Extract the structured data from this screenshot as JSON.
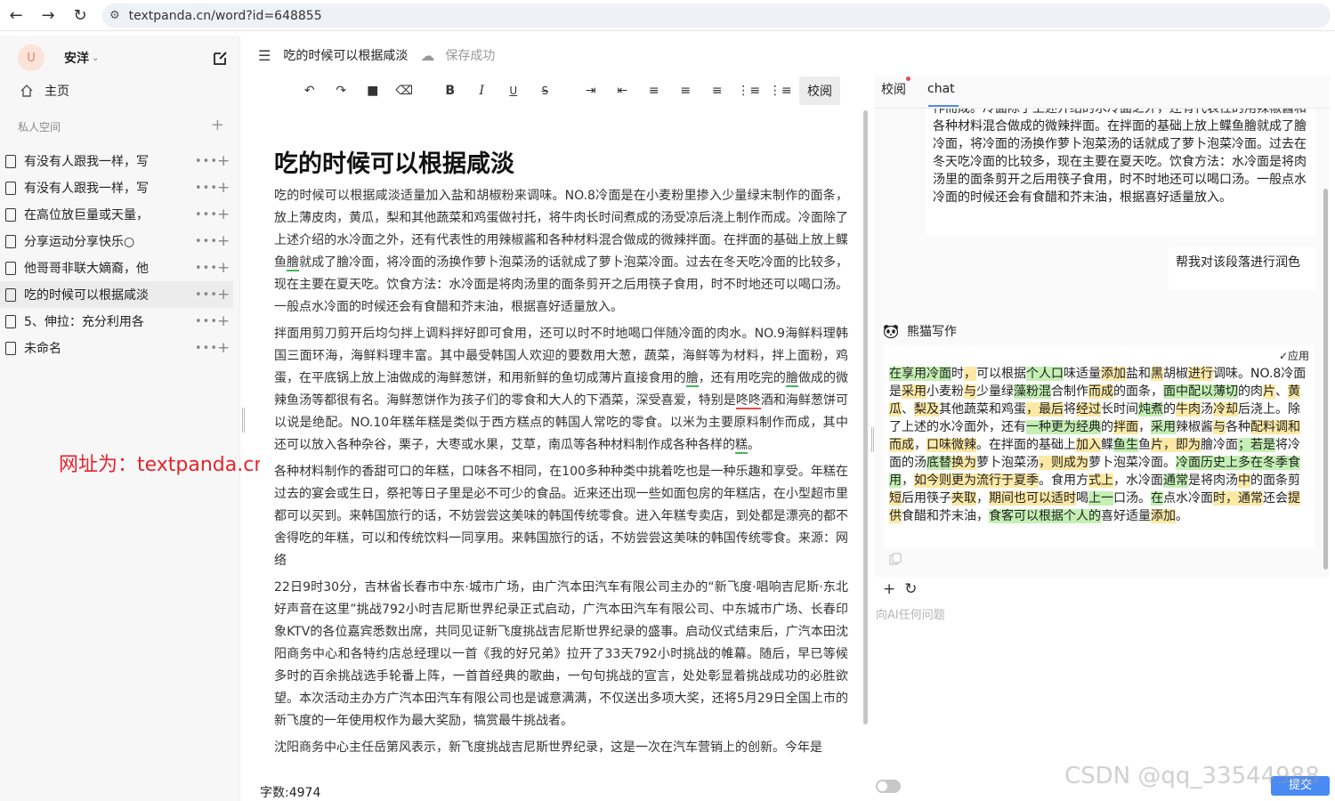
{
  "browser": {
    "url": "textpanda.cn/word?id=648855"
  },
  "sidebar": {
    "avatar_letter": "U",
    "user_name": "安洋",
    "home_label": "主页",
    "space_label": "私人空间",
    "docs": [
      {
        "title": "有没有人跟我一样，写"
      },
      {
        "title": "有没有人跟我一样，写"
      },
      {
        "title": "在高位放巨量或天量，"
      },
      {
        "title": "分享运动分享快乐○"
      },
      {
        "title": "他哥哥非联大嫡裔，他"
      },
      {
        "title": "吃的时候可以根据咸淡"
      },
      {
        "title": "5、伸拉：充分利用各"
      },
      {
        "title": "未命名"
      }
    ],
    "watermark": "网址为：textpanda.cn"
  },
  "header": {
    "doc_name": "吃的时候可以根据咸淡",
    "save_status": "保存成功"
  },
  "toolbar": {
    "check_label": "校阅"
  },
  "editor": {
    "title": "吃的时候可以根据咸淡",
    "p1_a": "吃的时候可以根据咸淡适量加入盐和胡椒粉来调味。NO.8冷面是在小麦粉里掺入少量绿末制作的面条，放上薄皮肉，黄瓜，梨和其他蔬菜和鸡蛋做衬托，将牛肉长时间煮成的汤受凉后浇上制作而成。冷面除了上述介绍的水冷面之外，还有代表性的用辣椒酱和各种材料混合做成的微辣拌面。在拌面的基础上放上鲽鱼",
    "p1_u": "膾",
    "p1_b": "就成了膾冷面，将冷面的汤换作萝卜泡菜汤的话就成了萝卜泡菜冷面。过去在冬天吃冷面的比较多，现在主要在夏天吃。饮食方法：水冷面是将肉汤里的面条剪开之后用筷子食用，时不时地还可以喝口汤。一般点水冷面的时候还会有食醋和芥末油，根据喜好适量放入。",
    "p2_a": "拌面用剪刀剪开后均匀拌上调料拌好即可食用，还可以时不时地喝口伴随冷面的肉水。NO.9海鲜料理韩国三面环海，海鲜料理丰富。其中最受韩国人欢迎的要数用大葱，蔬菜，海鲜等为材料，拌上面粉，鸡蛋，在平底锅上放上油做成的海鲜葱饼，和用新鲜的鱼切成薄片直接食用的",
    "p2_u1": "膾",
    "p2_b": "，还有用吃完的",
    "p2_u2": "膾",
    "p2_c": "做成的微辣鱼汤等都很有名。海鲜葱饼作为孩子们的零食和大人的下酒菜，深受喜爱，特别是",
    "p2_r": "咚咚",
    "p2_d": "酒和海鲜葱饼可以说是绝配。NO.10年糕年糕是类似于西方糕点的韩国人常吃的零食。以米为主要原料制作而成，其中还可以放入各种杂谷，栗子，大枣或水果，艾草，南瓜等各种材料制作成各种各样的",
    "p2_u3": "糕",
    "p2_e": "。",
    "p3": "各种材料制作的香甜可口的年糕，口味各不相同，在100多种种类中挑着吃也是一种乐趣和享受。年糕在过去的宴会或生日，祭祀等日子里是必不可少的食品。近来还出现一些如面包房的年糕店，在小型超市里都可以买到。来韩国旅行的话，不妨尝尝这美味的韩国传统零食。进入年糕专卖店，到处都是漂亮的都不舍得吃的年糕，可以和传统饮料一同享用。来韩国旅行的话，不妨尝尝这美味的韩国传统零食。来源：网络",
    "p4": "22日9时30分，吉林省长春市中东·城市广场，由广汽本田汽车有限公司主办的“新飞度·唱响吉尼斯·东北好声音在这里”挑战792小时吉尼斯世界纪录正式启动，广汽本田汽车有限公司、中东城市广场、长春印象KTV的各位嘉宾悉数出席，共同见证新飞度挑战吉尼斯世界纪录的盛事。启动仪式结束后，广汽本田沈阳商务中心和各特约店总经理以一首《我的好兄弟》拉开了33天792小时挑战的帷幕。随后，早已等候多时的百余挑战选手轮番上阵，一首首经典的歌曲，一句句挑战的宣言，处处彰显着挑战成功的必胜欲望。本次活动主办方广汽本田汽车有限公司也是诚意满满，不仅送出多项大奖，还将5月29日全国上市的新飞度的一年使用权作为最大奖励，犒赏最牛挑战者。",
    "p5": "沈阳商务中心主任岳第风表示，新飞度挑战吉尼斯世界纪录，这是一次在汽车营销上的创新。今年是",
    "word_count": "字数:4974"
  },
  "right_panel": {
    "tab_check": "校阅",
    "tab_chat": "chat",
    "msg_top": "作而成。冷面除了上述介绍的水冷面之外，还有代表性的用辣椒酱和各种材料混合做成的微辣拌面。在拌面的基础上放上鲽鱼膾就成了膾冷面，将冷面的汤换作萝卜泡菜汤的话就成了萝卜泡菜冷面。过去在冬天吃冷面的比较多，现在主要在夏天吃。饮食方法：水冷面是将肉汤里的面条剪开之后用筷子食用，时不时地还可以喝口汤。一般点水冷面的时候还会有食醋和芥末油，根据喜好适量放入。",
    "msg_user": "帮我对该段落进行润色",
    "ai_name": "熊猫写作",
    "apply_label": "✓应用",
    "ai_segments": [
      {
        "t": "在享用冷面",
        "h": "g"
      },
      {
        "t": "时",
        "h": ""
      },
      {
        "t": "，",
        "h": "y"
      },
      {
        "t": "可以根据",
        "h": ""
      },
      {
        "t": "个人口",
        "h": "g"
      },
      {
        "t": "味适量",
        "h": ""
      },
      {
        "t": "添加",
        "h": "y"
      },
      {
        "t": "盐和",
        "h": ""
      },
      {
        "t": "黑",
        "h": "y"
      },
      {
        "t": "胡椒",
        "h": ""
      },
      {
        "t": "进行",
        "h": "y"
      },
      {
        "t": "调味。NO.8冷面是",
        "h": ""
      },
      {
        "t": "采用",
        "h": "y"
      },
      {
        "t": "小麦粉",
        "h": ""
      },
      {
        "t": "与",
        "h": "y"
      },
      {
        "t": "少量绿",
        "h": ""
      },
      {
        "t": "藻粉混",
        "h": "g"
      },
      {
        "t": "合制作",
        "h": ""
      },
      {
        "t": "而成",
        "h": "y"
      },
      {
        "t": "的面条，",
        "h": ""
      },
      {
        "t": "面中配以薄切",
        "h": "g"
      },
      {
        "t": "的肉",
        "h": ""
      },
      {
        "t": "片",
        "h": "y"
      },
      {
        "t": "、",
        "h": ""
      },
      {
        "t": "黄瓜",
        "h": "y"
      },
      {
        "t": "、",
        "h": ""
      },
      {
        "t": "梨及",
        "h": "y"
      },
      {
        "t": "其他蔬菜和鸡蛋",
        "h": ""
      },
      {
        "t": "，最后",
        "h": "y"
      },
      {
        "t": "将",
        "h": ""
      },
      {
        "t": "经过",
        "h": "y"
      },
      {
        "t": "长时间",
        "h": ""
      },
      {
        "t": "炖煮",
        "h": "g"
      },
      {
        "t": "的",
        "h": ""
      },
      {
        "t": "牛肉",
        "h": "y"
      },
      {
        "t": "汤",
        "h": ""
      },
      {
        "t": "冷却",
        "h": "y"
      },
      {
        "t": "后浇上。除了上述的水冷面外，还有",
        "h": ""
      },
      {
        "t": "一种更为经典",
        "h": "g"
      },
      {
        "t": "的",
        "h": ""
      },
      {
        "t": "拌面",
        "h": "y"
      },
      {
        "t": "，",
        "h": ""
      },
      {
        "t": "采用",
        "h": "g"
      },
      {
        "t": "辣椒酱",
        "h": ""
      },
      {
        "t": "与",
        "h": "y"
      },
      {
        "t": "各种",
        "h": ""
      },
      {
        "t": "配料调和而成",
        "h": "y"
      },
      {
        "t": "，",
        "h": ""
      },
      {
        "t": "口味微辣",
        "h": "y"
      },
      {
        "t": "。在拌面的基础上",
        "h": ""
      },
      {
        "t": "加入",
        "h": "y"
      },
      {
        "t": "鲽",
        "h": ""
      },
      {
        "t": "鱼生",
        "h": "g"
      },
      {
        "t": "鱼",
        "h": ""
      },
      {
        "t": "片，即为",
        "h": "y"
      },
      {
        "t": "膾冷面",
        "h": ""
      },
      {
        "t": "；若是",
        "h": "g"
      },
      {
        "t": "将冷面的汤",
        "h": ""
      },
      {
        "t": "底替",
        "h": "g"
      },
      {
        "t": "换为",
        "h": "y"
      },
      {
        "t": "萝卜泡菜汤",
        "h": ""
      },
      {
        "t": "，则成为",
        "h": "y"
      },
      {
        "t": "萝卜泡菜冷面。",
        "h": ""
      },
      {
        "t": "冷面历史上多在冬季食用",
        "h": "g"
      },
      {
        "t": "，",
        "h": ""
      },
      {
        "t": "如今则更为流行于夏季",
        "h": "y"
      },
      {
        "t": "。食用方",
        "h": ""
      },
      {
        "t": "式上",
        "h": "y"
      },
      {
        "t": "，水冷面",
        "h": ""
      },
      {
        "t": "通常",
        "h": "g"
      },
      {
        "t": "是将肉汤",
        "h": ""
      },
      {
        "t": "中",
        "h": "y"
      },
      {
        "t": "的面条剪",
        "h": ""
      },
      {
        "t": "短",
        "h": "y"
      },
      {
        "t": "后用筷子",
        "h": ""
      },
      {
        "t": "夹取",
        "h": "y"
      },
      {
        "t": "，",
        "h": ""
      },
      {
        "t": "期间也可以适时",
        "h": "y"
      },
      {
        "t": "喝",
        "h": ""
      },
      {
        "t": "上一",
        "h": "g"
      },
      {
        "t": "口汤。",
        "h": ""
      },
      {
        "t": "在",
        "h": "g"
      },
      {
        "t": "点水冷面",
        "h": ""
      },
      {
        "t": "时，通常",
        "h": "y"
      },
      {
        "t": "还会",
        "h": ""
      },
      {
        "t": "提供",
        "h": "y"
      },
      {
        "t": "食醋和芥末油，",
        "h": ""
      },
      {
        "t": "食客可以根据个人的",
        "h": "g"
      },
      {
        "t": "喜好适量",
        "h": ""
      },
      {
        "t": "添加",
        "h": "y"
      },
      {
        "t": "。",
        "h": ""
      }
    ],
    "input_placeholder": "向AI任何问题",
    "submit_label": "提交"
  },
  "overlay": {
    "csdn": "CSDN @qq_33544988"
  },
  "colors": {
    "accent": "#4a8af4",
    "highlight_yellow": "#fde9a6",
    "highlight_green": "#c4f0b4",
    "watermark_red": "#e6232b"
  }
}
